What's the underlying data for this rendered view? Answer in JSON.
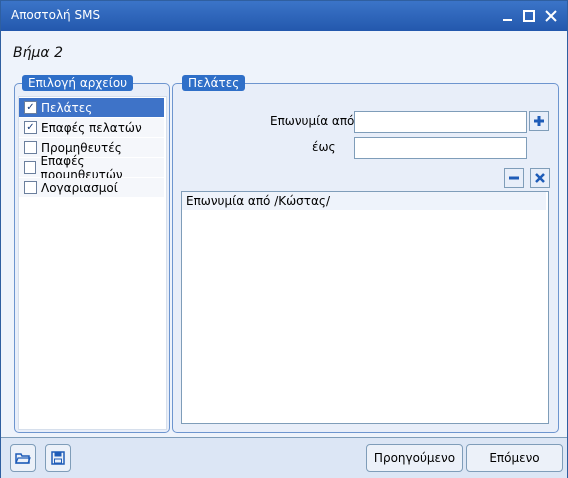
{
  "window": {
    "title": "Αποστολή SMS"
  },
  "step": {
    "title": "Βήμα 2"
  },
  "left_group": {
    "label": "Επιλογή αρχείου",
    "items": [
      {
        "label": "Πελάτες",
        "checked": true,
        "selected": true
      },
      {
        "label": "Επαφές πελατών",
        "checked": true,
        "selected": false
      },
      {
        "label": "Προμηθευτές",
        "checked": false,
        "selected": false
      },
      {
        "label": "Επαφές προμηθευτών",
        "checked": false,
        "selected": false
      },
      {
        "label": "Λογαριασμοί",
        "checked": false,
        "selected": false
      }
    ]
  },
  "right_group": {
    "label": "Πελάτες",
    "from_label": "Επωνυμία από",
    "to_label": "έως",
    "from_value": "",
    "to_value": "",
    "criteria": [
      "Επωνυμία από /Κώστας/"
    ]
  },
  "footer": {
    "prev_label": "Προηγούμενο",
    "next_label": "Επόμενο"
  },
  "icons": {
    "minimize": "minimize-icon",
    "maximize": "maximize-icon",
    "close": "close-icon",
    "add": "plus-icon",
    "remove": "minus-icon",
    "clear": "x-icon",
    "open": "folder-open-icon",
    "save": "save-disk-icon"
  },
  "colors": {
    "titlebar": "#2358ad",
    "selection": "#3e73c8",
    "icon_blue": "#1f5cb8"
  }
}
